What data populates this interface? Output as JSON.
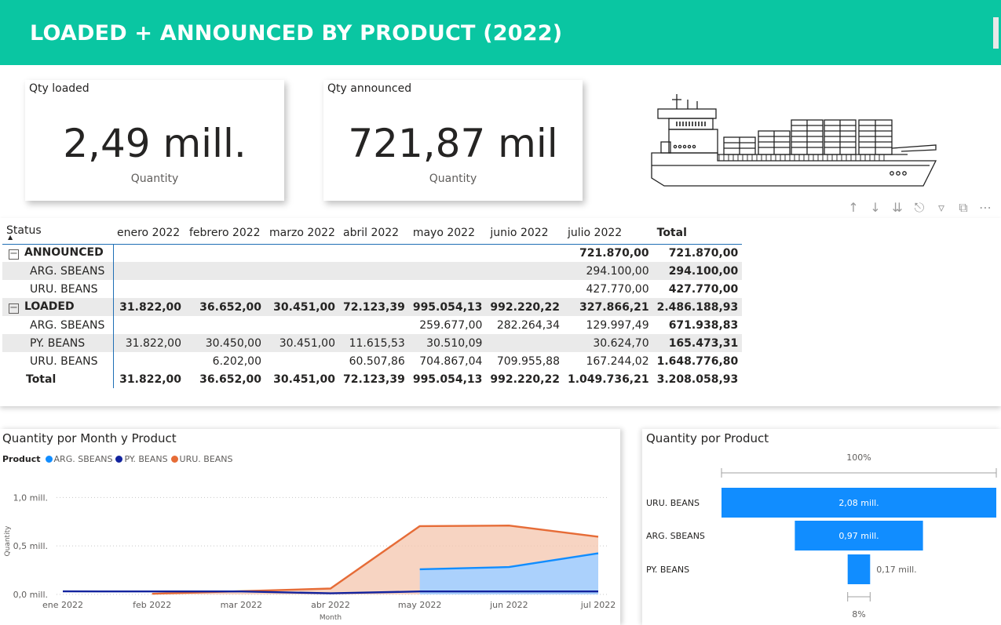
{
  "header": {
    "title": "LOADED + ANNOUNCED BY PRODUCT (2022)"
  },
  "cards": [
    {
      "title": "Qty loaded",
      "value": "2,49 mill.",
      "subtitle": "Quantity"
    },
    {
      "title": "Qty announced",
      "value": "721,87 mil",
      "subtitle": "Quantity"
    }
  ],
  "icons": {
    "ship": "container-ship-icon",
    "toolbar": [
      "drill-up-icon",
      "drill-down-icon",
      "expand-all-icon",
      "drill-hierarchy-icon",
      "filter-icon",
      "focus-mode-icon",
      "more-options-icon"
    ]
  },
  "matrix": {
    "row_header": "Status",
    "columns": [
      "enero 2022",
      "febrero 2022",
      "marzo 2022",
      "abril 2022",
      "mayo 2022",
      "junio 2022",
      "julio 2022",
      "Total"
    ],
    "groups": [
      {
        "label": "ANNOUNCED",
        "values": [
          "",
          "",
          "",
          "",
          "",
          "",
          "721.870,00",
          "721.870,00"
        ],
        "children": [
          {
            "label": "ARG. SBEANS",
            "values": [
              "",
              "",
              "",
              "",
              "",
              "",
              "294.100,00",
              "294.100,00"
            ]
          },
          {
            "label": "URU. BEANS",
            "values": [
              "",
              "",
              "",
              "",
              "",
              "",
              "427.770,00",
              "427.770,00"
            ]
          }
        ]
      },
      {
        "label": "LOADED",
        "values": [
          "31.822,00",
          "36.652,00",
          "30.451,00",
          "72.123,39",
          "995.054,13",
          "992.220,22",
          "327.866,21",
          "2.486.188,93"
        ],
        "children": [
          {
            "label": "ARG. SBEANS",
            "values": [
              "",
              "",
              "",
              "",
              "259.677,00",
              "282.264,34",
              "129.997,49",
              "671.938,83"
            ]
          },
          {
            "label": "PY. BEANS",
            "values": [
              "31.822,00",
              "30.450,00",
              "30.451,00",
              "11.615,53",
              "30.510,09",
              "",
              "30.624,70",
              "165.473,31"
            ]
          },
          {
            "label": "URU. BEANS",
            "values": [
              "",
              "6.202,00",
              "",
              "60.507,86",
              "704.867,04",
              "709.955,88",
              "167.244,02",
              "1.648.776,80"
            ]
          }
        ]
      }
    ],
    "total": {
      "label": "Total",
      "values": [
        "31.822,00",
        "36.652,00",
        "30.451,00",
        "72.123,39",
        "995.054,13",
        "992.220,22",
        "1.049.736,21",
        "3.208.058,93"
      ]
    }
  },
  "chart_data": [
    {
      "type": "area",
      "title": "Quantity por Month y Product",
      "legend_title": "Product",
      "legend_position": "top-left",
      "xlabel": "Month",
      "ylabel": "Quantity",
      "categories": [
        "ene 2022",
        "feb 2022",
        "mar 2022",
        "abr 2022",
        "may 2022",
        "jun 2022",
        "jul 2022"
      ],
      "yticks": [
        {
          "value": 0,
          "label": "0,0 mill."
        },
        {
          "value": 500000,
          "label": "0,5 mill."
        },
        {
          "value": 1000000,
          "label": "1,0 mill."
        }
      ],
      "ylim": [
        0,
        1100000
      ],
      "grid": true,
      "series": [
        {
          "name": "ARG. SBEANS",
          "color": "#118dff",
          "fill": "#a6d1ff",
          "values": [
            null,
            null,
            null,
            null,
            259677,
            282264,
            424097
          ]
        },
        {
          "name": "PY. BEANS",
          "color": "#12239e",
          "fill": "#12239e",
          "values": [
            31822,
            30450,
            30451,
            11616,
            30510,
            null,
            30625
          ]
        },
        {
          "name": "URU. BEANS",
          "color": "#e66c37",
          "fill": "#f4c5ae",
          "values": [
            null,
            6202,
            null,
            60508,
            704867,
            709956,
            595014
          ]
        }
      ]
    },
    {
      "type": "funnel",
      "title": "Quantity por Product",
      "top_label": "100%",
      "bottom_label": "8%",
      "color": "#118dff",
      "categories": [
        "URU. BEANS",
        "ARG. SBEANS",
        "PY. BEANS"
      ],
      "values": [
        2080000,
        970000,
        170000
      ],
      "value_labels": [
        "2,08 mill.",
        "0,97 mill.",
        "0,17 mill."
      ]
    }
  ]
}
